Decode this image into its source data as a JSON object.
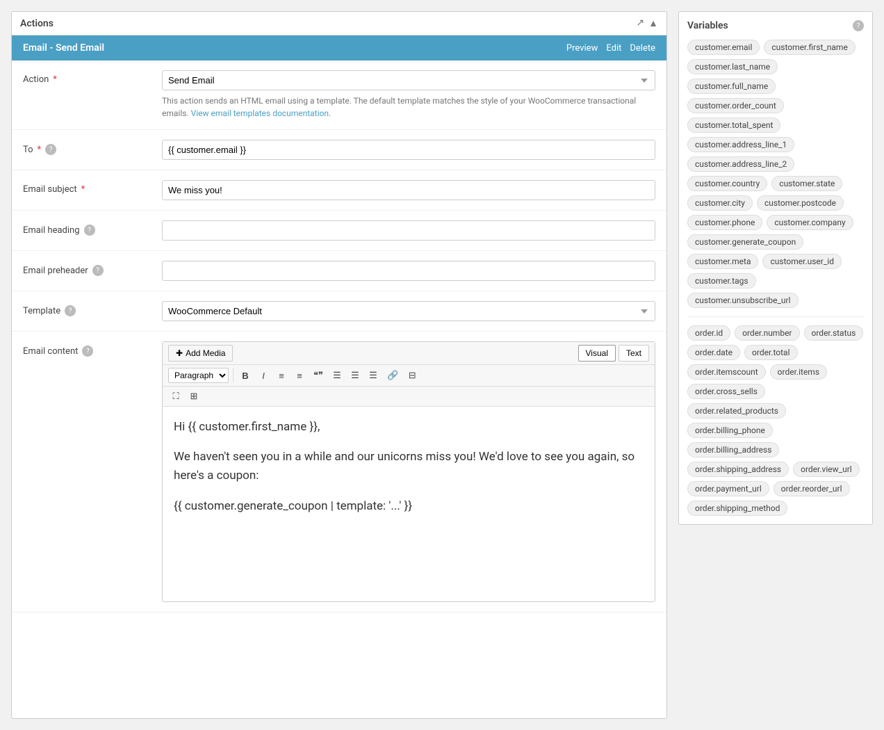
{
  "leftPanel": {
    "title": "Actions",
    "emailHeader": {
      "title": "Email - Send Email",
      "actions": [
        "Preview",
        "Edit",
        "Delete"
      ]
    },
    "form": {
      "actionLabel": "Action",
      "actionRequired": true,
      "actionValue": "Send Email",
      "actionOptions": [
        "Send Email"
      ],
      "actionHelp": "This action sends an HTML email using a template. The default template matches the style of your WooCommerce transactional emails.",
      "actionHelpLink": "View email templates documentation",
      "toLabel": "To",
      "toRequired": true,
      "toValue": "{{ customer.email }}",
      "toPlaceholder": "",
      "emailSubjectLabel": "Email subject",
      "emailSubjectRequired": true,
      "emailSubjectValue": "We miss you!",
      "emailHeadingLabel": "Email heading",
      "emailHeadingValue": "",
      "emailPreheaderLabel": "Email preheader",
      "emailPreheaderValue": "",
      "templateLabel": "Template",
      "templateValue": "WooCommerce Default",
      "templateOptions": [
        "WooCommerce Default"
      ],
      "emailContentLabel": "Email content",
      "addMediaLabel": "Add Media",
      "tabVisual": "Visual",
      "tabText": "Text",
      "toolbarOptions": [
        "Paragraph"
      ],
      "editorContent": {
        "line1": "Hi {{ customer.first_name }},",
        "line2": "We haven't seen you in a while and our unicorns miss you! We'd love to see you again, so here's a coupon:",
        "line3": "{{ customer.generate_coupon | template: '...' }}"
      }
    }
  },
  "rightPanel": {
    "title": "Variables",
    "variables": [
      "customer.email",
      "customer.first_name",
      "customer.last_name",
      "customer.full_name",
      "customer.order_count",
      "customer.total_spent",
      "customer.address_line_1",
      "customer.address_line_2",
      "customer.country",
      "customer.state",
      "customer.city",
      "customer.postcode",
      "customer.phone",
      "customer.company",
      "customer.generate_coupon",
      "customer.meta",
      "customer.user_id",
      "customer.tags",
      "customer.unsubscribe_url",
      "order.id",
      "order.number",
      "order.status",
      "order.date",
      "order.total",
      "order.itemscount",
      "order.items",
      "order.cross_sells",
      "order.related_products",
      "order.billing_phone",
      "order.billing_address",
      "order.shipping_address",
      "order.view_url",
      "order.payment_url",
      "order.reorder_url",
      "order.shipping_method"
    ]
  },
  "icons": {
    "external": "↗",
    "collapse": "▲",
    "help": "?",
    "addMedia": "✚",
    "bold": "B",
    "italic": "I",
    "bulletList": "≡",
    "numberedList": "≡",
    "blockquote": "❝",
    "alignLeft": "≡",
    "alignCenter": "≡",
    "alignRight": "≡",
    "link": "🔗",
    "hr": "⊟",
    "fullscreen": "⛶",
    "grid": "⊞"
  }
}
